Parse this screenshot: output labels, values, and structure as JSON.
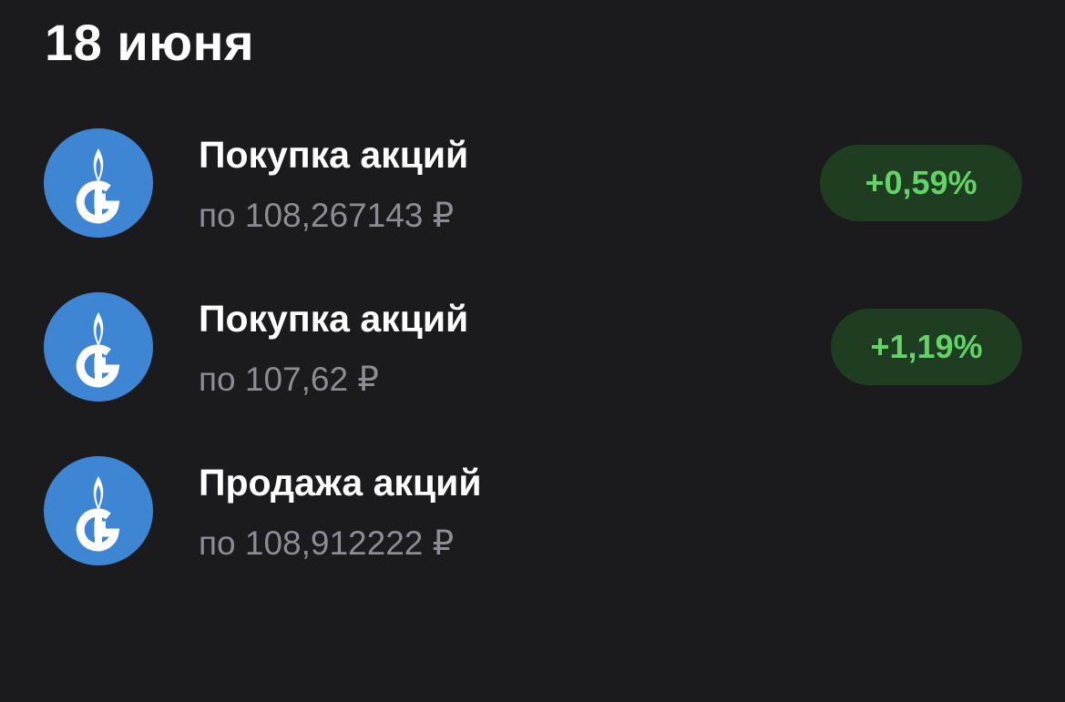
{
  "header": {
    "date": "18 июня"
  },
  "operations": [
    {
      "title": "Покупка акций",
      "price": "по 108,267143 ₽",
      "change": "+0,59%",
      "logo_icon": "gazprom-logo-icon"
    },
    {
      "title": "Покупка акций",
      "price": "по 107,62 ₽",
      "change": "+1,19%",
      "logo_icon": "gazprom-logo-icon"
    },
    {
      "title": "Продажа акций",
      "price": "по 108,912222 ₽",
      "logo_icon": "gazprom-logo-icon"
    }
  ],
  "colors": {
    "background": "#1b1b1d",
    "logo_blue": "#3e85d3",
    "badge_bg": "#1f3d20",
    "badge_text": "#63d267",
    "secondary_text": "#8c8c92"
  }
}
